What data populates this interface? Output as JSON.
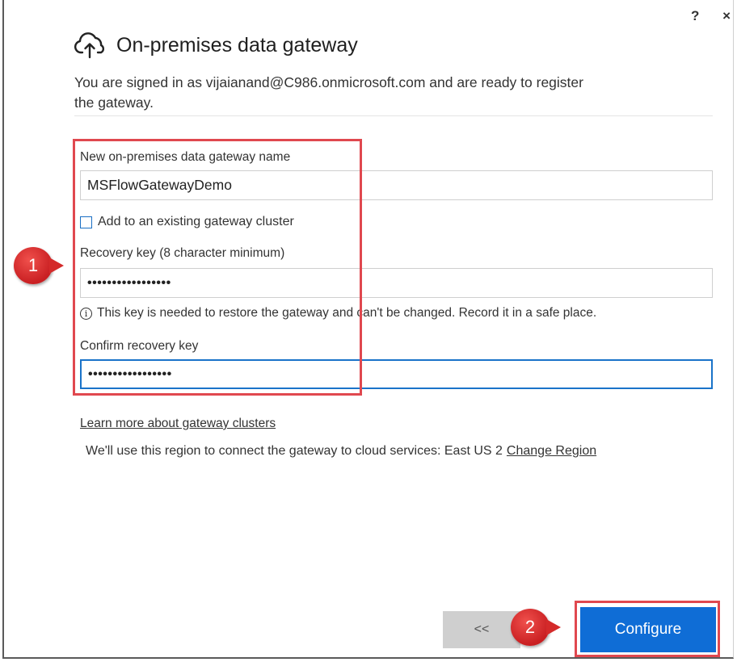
{
  "window": {
    "help_label": "?",
    "close_label": "×",
    "title": "On-premises data gateway",
    "icon": "cloud-upload-icon"
  },
  "intro": {
    "line1": "You are signed in as vijaianand@C986.onmicrosoft.com and are ready to register",
    "line2": "the gateway."
  },
  "form": {
    "gateway_name_label": "New on-premises data gateway name",
    "gateway_name_value": "MSFlowGatewayDemo",
    "add_cluster_label": "Add to an existing gateway cluster",
    "add_cluster_checked": false,
    "recovery_key_label": "Recovery key (8 character minimum)",
    "recovery_key_value": "•••••••••••••••••",
    "recovery_note": "This key is needed to restore the gateway and can't be changed. Record it in a safe place.",
    "confirm_key_label": "Confirm recovery key",
    "confirm_key_value": "•••••••••••••••••"
  },
  "links": {
    "learn_more": "Learn more about gateway clusters",
    "region_text": "We'll use this region to connect the gateway to cloud services: East US 2",
    "change_region": "Change Region"
  },
  "buttons": {
    "back_label": "<<",
    "configure_label": "Configure"
  },
  "callouts": {
    "one": "1",
    "two": "2"
  },
  "colors": {
    "accent": "#0f6dd6",
    "annotation_red": "#e0484f"
  }
}
